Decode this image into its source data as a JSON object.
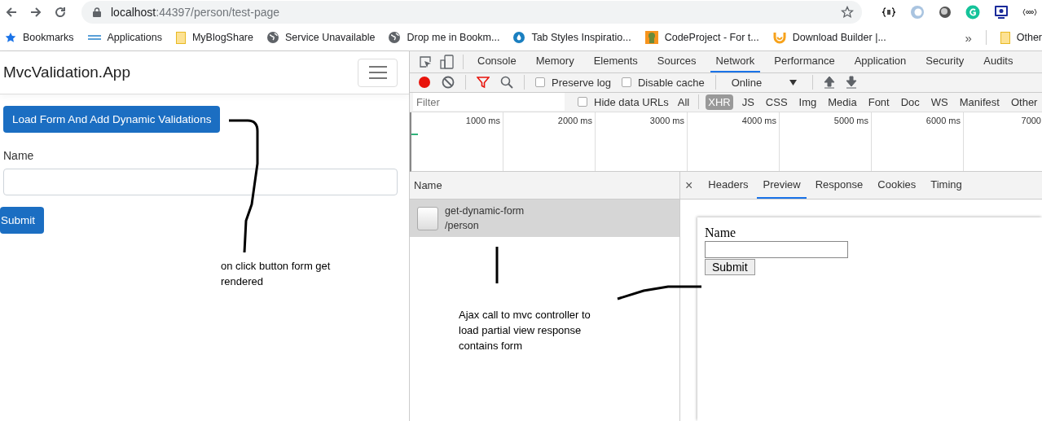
{
  "browser": {
    "address_host": "localhost",
    "address_path": ":44397/person/test-page",
    "bookmarks": [
      {
        "label": "Bookmarks",
        "kind": "star"
      },
      {
        "label": "Applications",
        "kind": "apps"
      },
      {
        "label": "MyBlogShare",
        "kind": "folder"
      },
      {
        "label": "Service Unavailable",
        "kind": "globe"
      },
      {
        "label": "Drop me in Bookm...",
        "kind": "globe"
      },
      {
        "label": "Tab Styles Inspiratio...",
        "kind": "drop"
      },
      {
        "label": "CodeProject - For t...",
        "kind": "mascot"
      },
      {
        "label": "Download Builder |...",
        "kind": "ui"
      }
    ],
    "more": "»",
    "other": "Other"
  },
  "page": {
    "brand": "MvcValidation.App",
    "load_button": "Load Form And Add Dynamic Validations",
    "field_label": "Name",
    "submit": "Submit"
  },
  "devtools": {
    "tabs": [
      {
        "label": "Console",
        "selected": false
      },
      {
        "label": "Memory",
        "selected": false
      },
      {
        "label": "Elements",
        "selected": false
      },
      {
        "label": "Sources",
        "selected": false
      },
      {
        "label": "Network",
        "selected": true
      },
      {
        "label": "Performance",
        "selected": false
      },
      {
        "label": "Application",
        "selected": false
      },
      {
        "label": "Security",
        "selected": false
      },
      {
        "label": "Audits",
        "selected": false
      }
    ],
    "recording": true,
    "preserve_log": {
      "label": "Preserve log",
      "checked": false
    },
    "disable_cache": {
      "label": "Disable cache",
      "checked": false
    },
    "throttle": "Online",
    "filter_placeholder": "Filter",
    "hide_data_urls": {
      "label": "Hide data URLs",
      "checked": false
    },
    "types": [
      {
        "label": "All",
        "selected": false
      },
      {
        "label": "XHR",
        "selected": true
      },
      {
        "label": "JS",
        "selected": false
      },
      {
        "label": "CSS",
        "selected": false
      },
      {
        "label": "Img",
        "selected": false
      },
      {
        "label": "Media",
        "selected": false
      },
      {
        "label": "Font",
        "selected": false
      },
      {
        "label": "Doc",
        "selected": false
      },
      {
        "label": "WS",
        "selected": false
      },
      {
        "label": "Manifest",
        "selected": false
      },
      {
        "label": "Other",
        "selected": false
      }
    ],
    "timeline": [
      "1000 ms",
      "2000 ms",
      "3000 ms",
      "4000 ms",
      "5000 ms",
      "6000 ms",
      "7000"
    ],
    "name_header": "Name",
    "requests": [
      {
        "name": "get-dynamic-form",
        "path": "/person",
        "selected": true
      }
    ],
    "close": "×",
    "detail_tabs": [
      {
        "label": "Headers",
        "selected": false
      },
      {
        "label": "Preview",
        "selected": true
      },
      {
        "label": "Response",
        "selected": false
      },
      {
        "label": "Cookies",
        "selected": false
      },
      {
        "label": "Timing",
        "selected": false
      }
    ],
    "preview": {
      "label": "Name",
      "button": "Submit"
    }
  },
  "annotations": [
    "on click button form get rendered",
    "Ajax call to mvc controller to load partial view response contains form"
  ]
}
